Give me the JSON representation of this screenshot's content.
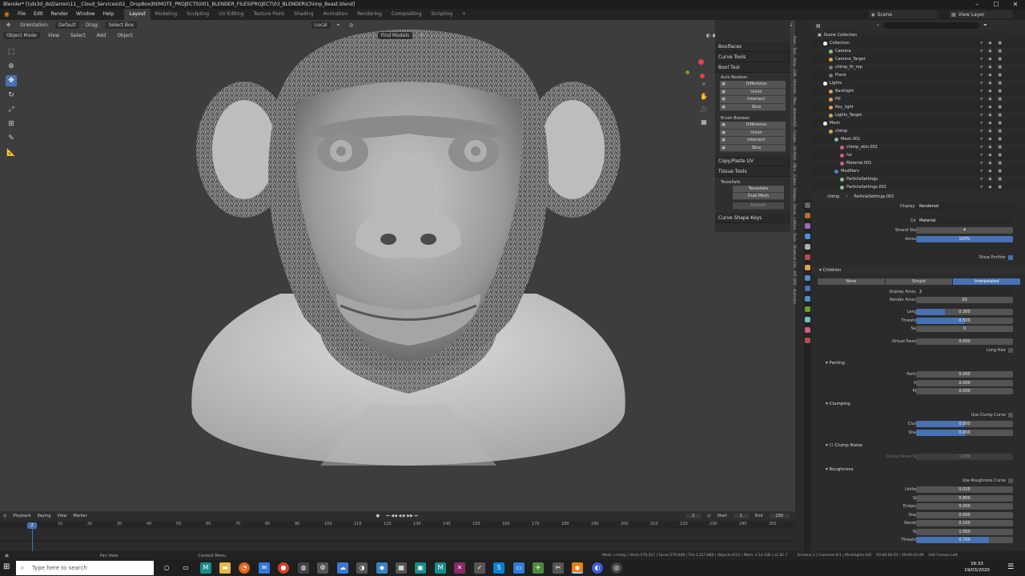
{
  "window": {
    "title": "Blender* [\\\\ds3d_ds\\Darren\\11__Cloud_Services\\02__DropBox\\REMOTE_PROJECTS\\001_BLENDER_FILES\\PROJECT\\03_BLENDER\\Chimp_Beast.blend]",
    "minimize": "–",
    "maximize": "☐",
    "close": "✕"
  },
  "menu": [
    "File",
    "Edit",
    "Render",
    "Window",
    "Help"
  ],
  "workspaces": [
    "Layout",
    "Modeling",
    "Sculpting",
    "UV Editing",
    "Texture Paint",
    "Shading",
    "Animation",
    "Rendering",
    "Compositing",
    "Scripting"
  ],
  "add_workspace": "+",
  "scene": {
    "label": "Scene",
    "view_layer": "View Layer"
  },
  "viewport": {
    "mode": "Object Mode",
    "orientation_label": "Orientation:",
    "orientation": "Default",
    "drag_label": "Drag:",
    "drag": "Select Box",
    "menus": [
      "View",
      "Select",
      "Add",
      "Object"
    ],
    "pivot": "Local",
    "find_models": "Find Models",
    "options": "Options"
  },
  "npanel": {
    "sections": {
      "boolfaces": "Boolfaces",
      "curve_tools": "Curve Tools",
      "bool_tool": "Bool Tool",
      "auto_boolean": "Auto Boolean",
      "brush_boolean": "Brush Boolean",
      "copy_paste_uv": "Copy/Paste UV",
      "tissue_tools": "Tissue Tools",
      "tessellate": "Tessellate",
      "curve_shape_keys": "Curve Shape Keys"
    },
    "auto_ops": [
      "Difference",
      "Union",
      "Intersect",
      "Slice"
    ],
    "brush_ops": [
      "Difference",
      "Union",
      "Intersect",
      "Slice"
    ],
    "tess_buttons": [
      "Tessellate",
      "Dual Mesh",
      "Refresh"
    ],
    "tabs": [
      "Item",
      "Tool",
      "View",
      "Edit",
      "Remesh",
      "Misc",
      "BlenderKit",
      "Create",
      "3D-Print",
      "Mira",
      "Cuber",
      "Retopo",
      "Decal",
      "Lattice",
      "Tools",
      "Shortcut VUr",
      "KIT OPS",
      "Animate"
    ]
  },
  "outliner": {
    "header": "Scene Collection",
    "rows": [
      {
        "name": "Collection",
        "indent": 1,
        "color": "#ffffff"
      },
      {
        "name": "Camera",
        "indent": 2,
        "color": "#8fbf8f"
      },
      {
        "name": "Camera_Target",
        "indent": 2,
        "color": "#e0a050"
      },
      {
        "name": "chimp_fir_rep",
        "indent": 2,
        "color": "#777777"
      },
      {
        "name": "Plane",
        "indent": 2,
        "color": "#777777"
      },
      {
        "name": "Lights",
        "indent": 1,
        "color": "#ffffff"
      },
      {
        "name": "Backlight",
        "indent": 2,
        "color": "#e0a050"
      },
      {
        "name": "Fill",
        "indent": 2,
        "color": "#e0a050"
      },
      {
        "name": "Key_light",
        "indent": 2,
        "color": "#e0a050"
      },
      {
        "name": "Lights_Target",
        "indent": 2,
        "color": "#e0a050"
      },
      {
        "name": "Mesh",
        "indent": 1,
        "color": "#ffffff"
      },
      {
        "name": "chimp",
        "indent": 2,
        "color": "#e0a050"
      },
      {
        "name": "Mesh.001",
        "indent": 3,
        "color": "#6fc0c0"
      },
      {
        "name": "chimp_skin.001",
        "indent": 4,
        "color": "#d06080"
      },
      {
        "name": "fur",
        "indent": 4,
        "color": "#d06080"
      },
      {
        "name": "Material.001",
        "indent": 4,
        "color": "#d06080"
      },
      {
        "name": "Modifiers",
        "indent": 3,
        "color": "#5080d0"
      },
      {
        "name": "ParticleSettings",
        "indent": 4,
        "color": "#8fbf8f"
      },
      {
        "name": "ParticleSettings.001",
        "indent": 4,
        "color": "#8fbf8f"
      }
    ]
  },
  "properties": {
    "breadcrumb": [
      "chimp",
      "ParticleSettings.001"
    ],
    "display_as": {
      "label": "Display As",
      "value": "Rendered"
    },
    "color": {
      "label": "Color",
      "value": "Material"
    },
    "strand_steps": {
      "label": "Strand Steps",
      "value": "4"
    },
    "amount": {
      "label": "Amount",
      "value": "100%",
      "fraction": 1.0
    },
    "show_emitter": "Show Emitter",
    "children": {
      "title": "Children",
      "modes": [
        "None",
        "Simple",
        "Interpolated"
      ],
      "display_amount": {
        "label": "Display Amount",
        "value": "2"
      },
      "render_amount": {
        "label": "Render Amount",
        "value": "20"
      },
      "length": {
        "label": "Length",
        "value": "0.300",
        "fraction": 0.3
      },
      "threshold": {
        "label": "Threshold",
        "value": "0.500",
        "fraction": 0.5
      },
      "seed": {
        "label": "Seed",
        "value": "0"
      },
      "virtual_parents": {
        "label": "Virtual Parents",
        "value": "0.000"
      },
      "long_hair": "Long Hair"
    },
    "parting": {
      "title": "Parting",
      "parting": {
        "label": "Parting",
        "value": "0.000"
      },
      "min": {
        "label": "Min",
        "value": "0.000"
      },
      "max": {
        "label": "Max",
        "value": "0.000"
      }
    },
    "clumping": {
      "title": "Clumping",
      "use_curve": "Use Clump Curve",
      "clump": {
        "label": "Clump",
        "value": "0.000",
        "fraction": 0.5
      },
      "shape": {
        "label": "Shape",
        "value": "0.000",
        "fraction": 0.5
      }
    },
    "clump_noise": {
      "title": "Clump Noise",
      "size_label": "Clump Noise Size",
      "size": "1.000"
    },
    "roughness": {
      "title": "Roughness",
      "use_curve": "Use Roughness Curve",
      "rows": [
        {
          "label": "Uniform",
          "value": "0.025"
        },
        {
          "label": "Size",
          "value": "0.800"
        },
        {
          "label": "Endpoint",
          "value": "0.000"
        },
        {
          "label": "Shape",
          "value": "0.000"
        },
        {
          "label": "Random",
          "value": "0.100"
        },
        {
          "label": "Size",
          "value": "1.000"
        },
        {
          "label": "Threshold",
          "value": "0.750",
          "fraction": 0.75
        }
      ]
    }
  },
  "timeline": {
    "menus": [
      "Playback",
      "Keying",
      "View",
      "Marker"
    ],
    "current_frame": "2",
    "frame_field": "2",
    "start_label": "Start",
    "start": "1",
    "end_label": "End",
    "end": "250",
    "ticks": [
      "10",
      "20",
      "30",
      "40",
      "50",
      "60",
      "70",
      "80",
      "90",
      "100",
      "110",
      "120",
      "130",
      "140",
      "150",
      "160",
      "170",
      "180",
      "190",
      "200",
      "210",
      "220",
      "230",
      "240",
      "250"
    ]
  },
  "statusbar": {
    "left": "Pan View",
    "mid": "Context Menu",
    "stats": "Mesh | chimp | Verts:579,317 | Faces:579,008 | Tris:1,157,880 | Objects:0/12 | Mem: 2.14 GiB | v2.82.7",
    "scene_info": "Screens:1 | Cameras:0/1 | Meshlights:0/0",
    "time": "00:00:00:01 / 00:00:10:09",
    "frames_left": "240 Frames Left"
  },
  "taskbar": {
    "search_placeholder": "Type here to search",
    "clock": "16:33",
    "date": "19/03/2020"
  },
  "colors": {
    "accent": "#4772b3",
    "viewport": "#3d3d3d",
    "panel": "#2b2b2b"
  }
}
